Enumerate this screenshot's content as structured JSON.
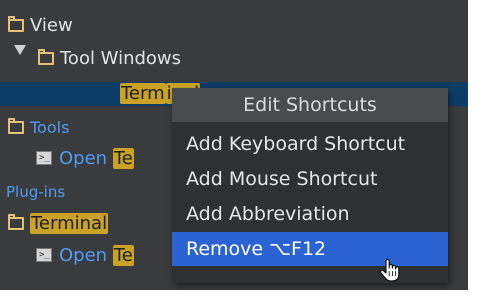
{
  "tree": {
    "view_label": "View",
    "tool_windows_label": "Tool Windows",
    "terminal_child": "Term",
    "terminal_child_hidden": "inal",
    "tools_label": "Tools",
    "open_label_1": "Open",
    "open_hl_1": "Te",
    "plugins_label": "Plug-ins",
    "terminal_folder_label": "Terminal",
    "open_label_2": "Open",
    "open_hl_2": "Te",
    "term_icon_glyph": ">_"
  },
  "context_menu": {
    "header": "Edit Shortcuts",
    "items": [
      {
        "label": "Add Keyboard Shortcut"
      },
      {
        "label": "Add Mouse Shortcut"
      },
      {
        "label": "Add Abbreviation"
      },
      {
        "label": "Remove ⌥F12",
        "active": true
      }
    ]
  },
  "colors": {
    "panel_bg": "#3a3b3d",
    "selection": "#0d3c66",
    "highlight": "#c9a227",
    "menu_active": "#2b63d2",
    "section_text": "#4f9bf6"
  },
  "icons": {
    "folder": "folder-icon",
    "expand": "expand-triangle-icon",
    "terminal": "terminal-icon",
    "cursor": "hand-cursor-icon"
  }
}
